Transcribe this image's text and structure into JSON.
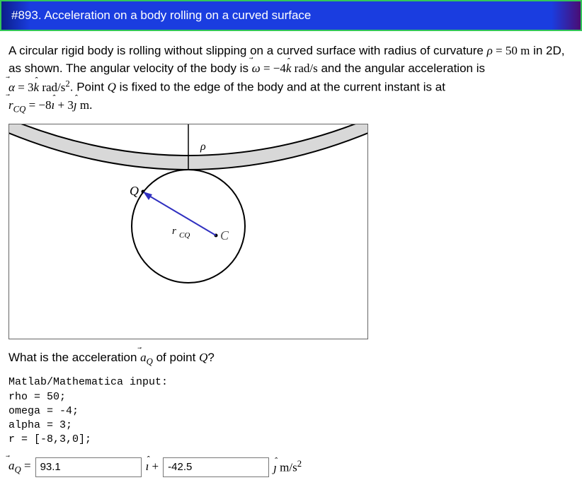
{
  "header": {
    "title": "#893. Acceleration on a body rolling on a curved surface"
  },
  "problem": {
    "line1a": "A circular rigid body is rolling without slipping on a curved surface with radius of curvature ",
    "rho_eq": "ρ = 50 m",
    "line1b": " in 2D,",
    "line2a": "as shown. The angular velocity of the body is ",
    "omega_eq_lhs": "ω⃗ = ",
    "omega_eq_rhs_num": "−4",
    "omega_eq_unit": " rad/s",
    "line2b": " and the angular acceleration is",
    "alpha_eq_lhs": "α⃗ = ",
    "alpha_eq_rhs_num": "3",
    "alpha_eq_unit": " rad/s",
    "line3a": ". Point ",
    "Q": "Q",
    "line3b": " is fixed to the edge of the body and at the current instant is at",
    "r_eq_lhs": "r⃗",
    "r_eq_sub": "CQ",
    "r_eq_rhs_a": " = −8",
    "r_eq_rhs_b": " + 3",
    "r_eq_unit": " m."
  },
  "figure": {
    "rho_label": "ρ",
    "Q_label": "Q",
    "C_label": "C",
    "rCQ_label": "r⃗",
    "rCQ_sub": "CQ"
  },
  "question": {
    "prefix": "What is the acceleration ",
    "aQ_lhs": "a⃗",
    "aQ_sub": "Q",
    "suffix": " of point ",
    "Q": "Q",
    "end": "?"
  },
  "code": {
    "title": "Matlab/Mathematica input:",
    "l1": "rho = 50;",
    "l2": "omega = -4;",
    "l3": "alpha = 3;",
    "l4": "r = [-8,3,0];"
  },
  "answer": {
    "lhs": "a⃗",
    "sub": "Q",
    "eq": " = ",
    "val_i": "93.1",
    "mid": " + ",
    "val_j": "-42.5",
    "unit": " m/s"
  }
}
